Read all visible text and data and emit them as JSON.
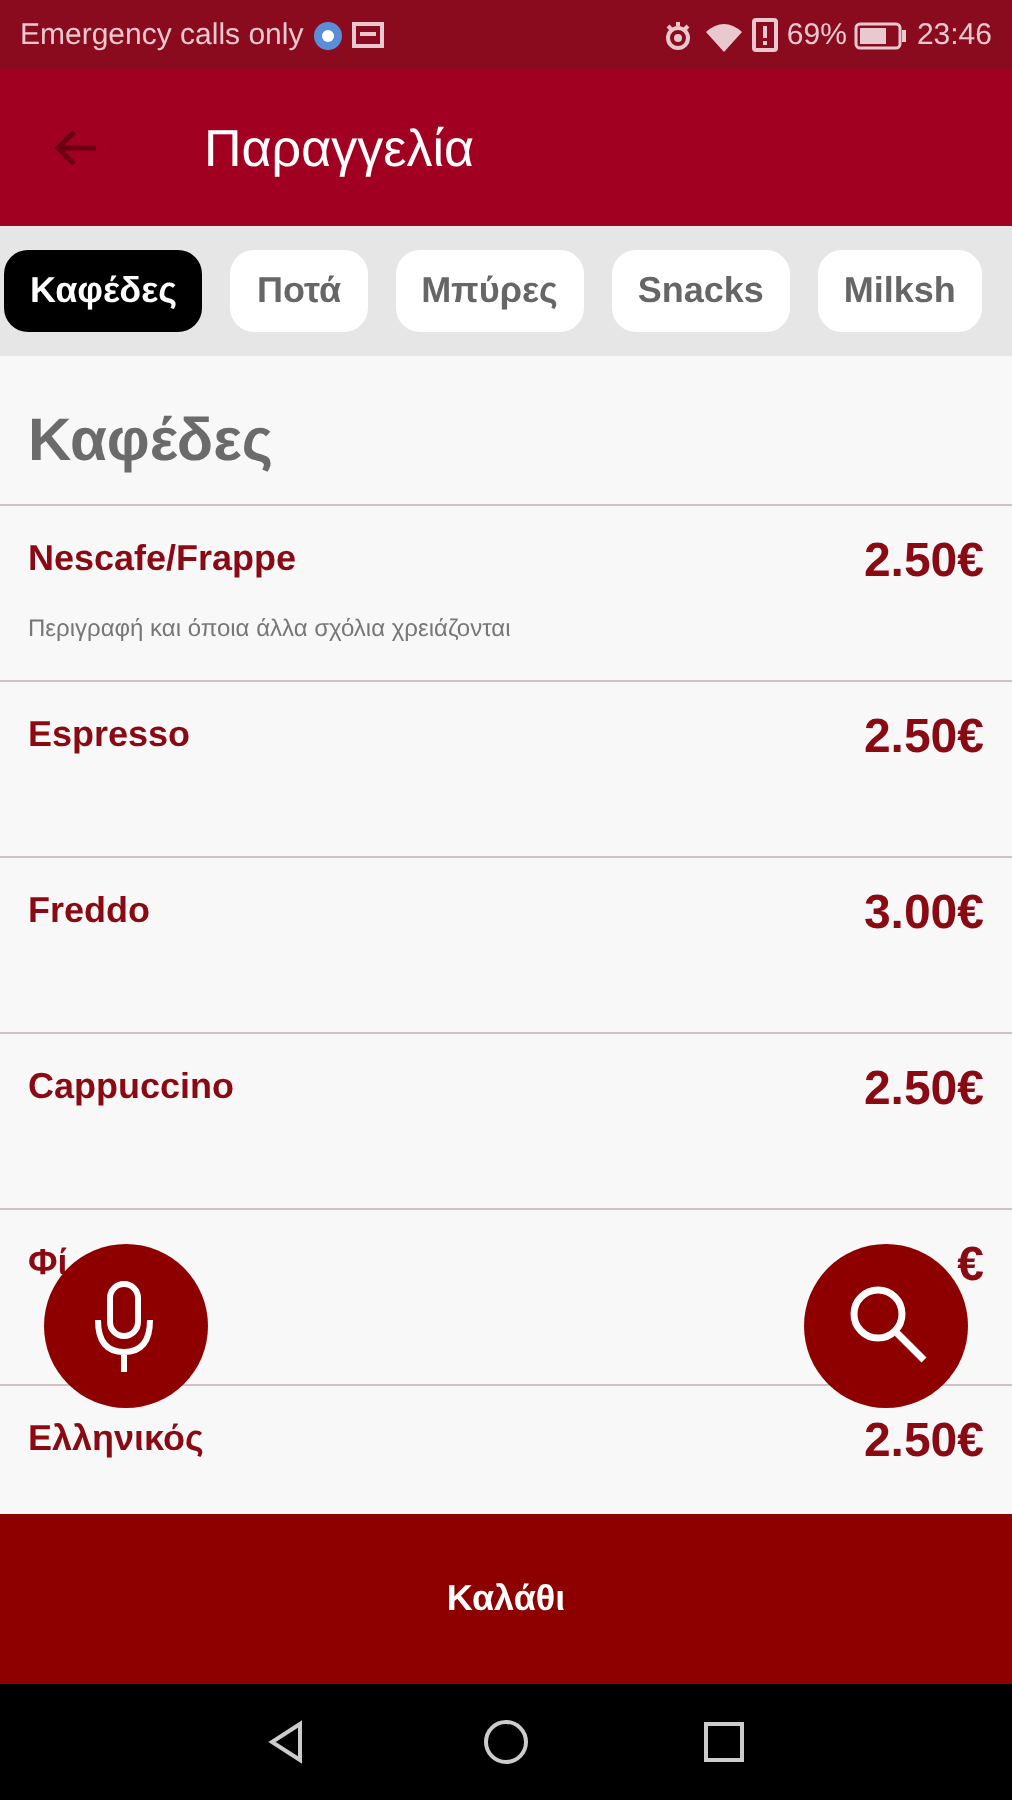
{
  "status_bar": {
    "carrier": "Emergency calls only",
    "battery": "69%",
    "time": "23:46"
  },
  "app_bar": {
    "title": "Παραγγελία"
  },
  "categories": [
    {
      "label": "Καφέδες",
      "selected": true
    },
    {
      "label": "Ποτά",
      "selected": false
    },
    {
      "label": "Μπύρες",
      "selected": false
    },
    {
      "label": "Snacks",
      "selected": false
    },
    {
      "label": "Milksh",
      "selected": false
    }
  ],
  "section": {
    "title": "Καφέδες"
  },
  "items": [
    {
      "name": "Nescafe/Frappe",
      "price": "2.50€",
      "description": "Περιγραφή και όποια άλλα σχόλια χρειάζονται"
    },
    {
      "name": "Espresso",
      "price": "2.50€"
    },
    {
      "name": "Freddo",
      "price": "3.00€"
    },
    {
      "name": "Cappuccino",
      "price": "2.50€"
    },
    {
      "name": "Φί",
      "price": "€"
    },
    {
      "name": "Ελληνικός",
      "price": "2.50€"
    }
  ],
  "basket_button": {
    "label": "Καλάθι"
  }
}
